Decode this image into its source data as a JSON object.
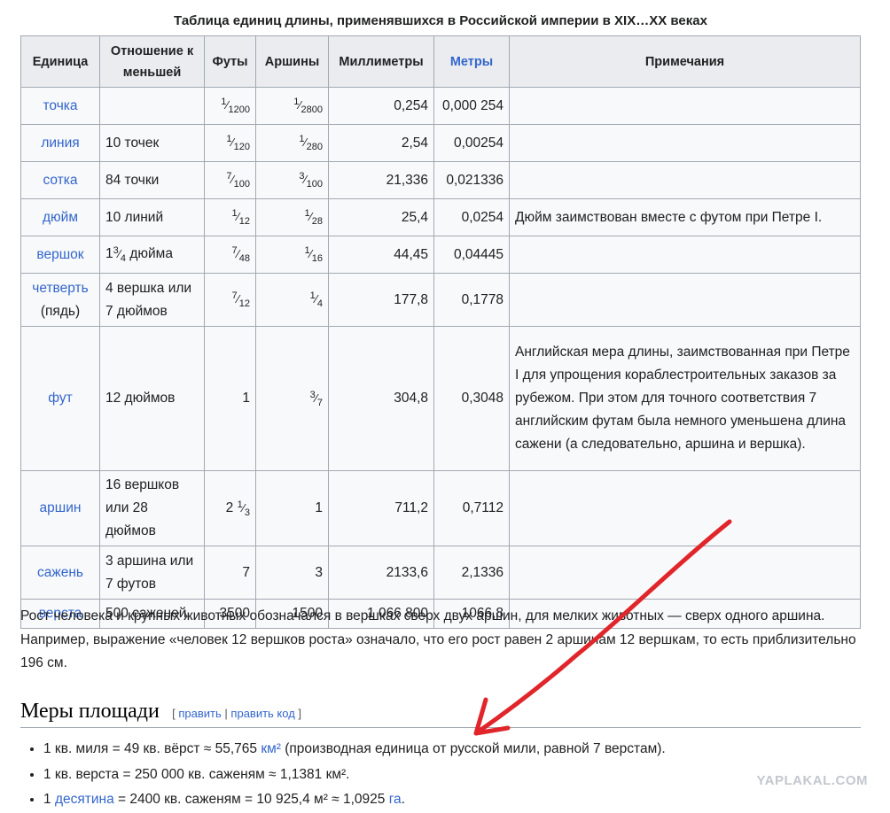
{
  "caption": "Таблица единиц длины, применявшихся в Российской империи в XIX…XX веках",
  "headers": [
    "Единица",
    "Отношение к меньшей",
    "Футы",
    "Аршины",
    "Миллиметры",
    "Метры",
    "Примечания"
  ],
  "rows": [
    {
      "unit": "точка",
      "unit_suffix": "",
      "relation": "",
      "feet": {
        "num": "1",
        "den": "1200"
      },
      "arshins": {
        "num": "1",
        "den": "2800"
      },
      "mm": "0,254",
      "m": "0,000 254",
      "note": ""
    },
    {
      "unit": "линия",
      "unit_suffix": "",
      "relation": "10 точек",
      "feet": {
        "num": "1",
        "den": "120"
      },
      "arshins": {
        "num": "1",
        "den": "280"
      },
      "mm": "2,54",
      "m": "0,00254",
      "note": ""
    },
    {
      "unit": "сотка",
      "unit_suffix": "",
      "relation": "84 точки",
      "feet": {
        "num": "7",
        "den": "100"
      },
      "arshins": {
        "num": "3",
        "den": "100"
      },
      "mm": "21,336",
      "m": "0,021336",
      "note": ""
    },
    {
      "unit": "дюйм",
      "unit_suffix": "",
      "relation": "10 линий",
      "feet": {
        "num": "1",
        "den": "12"
      },
      "arshins": {
        "num": "1",
        "den": "28"
      },
      "mm": "25,4",
      "m": "0,0254",
      "note": "Дюйм заимствован вместе с футом при Петре I."
    },
    {
      "unit": "вершок",
      "unit_suffix": "",
      "relation_whole": "1",
      "relation_frac": {
        "num": "3",
        "den": "4"
      },
      "relation_tail": " дюйма",
      "feet": {
        "num": "7",
        "den": "48"
      },
      "arshins": {
        "num": "1",
        "den": "16"
      },
      "mm": "44,45",
      "m": "0,04445",
      "note": ""
    },
    {
      "unit": "четверть",
      "unit_suffix": "(пядь)",
      "relation": "4 вершка или 7 дюймов",
      "feet": {
        "num": "7",
        "den": "12"
      },
      "arshins": {
        "num": "1",
        "den": "4"
      },
      "mm": "177,8",
      "m": "0,1778",
      "note": ""
    },
    {
      "unit": "фут",
      "unit_suffix": "",
      "relation": "12 дюймов",
      "feet_plain": "1",
      "arshins": {
        "num": "3",
        "den": "7"
      },
      "mm": "304,8",
      "m": "0,3048",
      "note": "Английская мера длины, заимствованная при Петре I для упрощения кораблестроительных заказов за рубежом. При этом для точного соответствия 7 английским футам была немного уменьшена длина сажени (а следовательно, аршина и вершка)."
    },
    {
      "unit": "аршин",
      "unit_suffix": "",
      "relation": "16 вершков или 28 дюймов",
      "feet_whole": "2",
      "feet": {
        "num": "1",
        "den": "3"
      },
      "arshins_plain": "1",
      "mm": "711,2",
      "m": "0,7112",
      "note": ""
    },
    {
      "unit": "сажень",
      "unit_suffix": "",
      "relation": "3 аршина или 7 футов",
      "feet_plain": "7",
      "arshins_plain": "3",
      "mm": "2133,6",
      "m": "2,1336",
      "note": ""
    },
    {
      "unit": "верста",
      "unit_suffix": "",
      "relation": "500 саженей",
      "feet_plain": "3500",
      "arshins_plain": "1500",
      "mm": "1 066 800",
      "m": "1066,8",
      "note": ""
    }
  ],
  "paragraph": "Рост человека и крупных животных обозначался в вершках сверх двух аршин, для мелких животных — сверх одного аршина. Например, выражение «человек 12 вершков роста» означало, что его рост равен 2 аршинам 12 вершкам, то есть приблизительно 196 см.",
  "section": {
    "title": "Меры площади",
    "edit_open": "[",
    "edit_link": "править",
    "edit_sep": "|",
    "edit_code_link": "править код",
    "edit_close": "]"
  },
  "bullets": [
    {
      "pre": "1 кв. миля = 49 кв. вёрст ≈ 55,765 ",
      "link": "км²",
      "post": " (производная единица от русской мили, равной 7 верстам)."
    },
    {
      "pre": "1 кв. верста = 250 000 кв. саженям ≈ 1,1381 км².",
      "link": "",
      "post": ""
    },
    {
      "pre": "1 ",
      "link": "десятина",
      "post": " = 2400 кв. саженям = 10 925,4 м² ≈ 1,0925 ",
      "link2": "га",
      "post2": "."
    }
  ],
  "watermark": "YAPLAKAL.COM",
  "annotation_color": "#e0262b"
}
